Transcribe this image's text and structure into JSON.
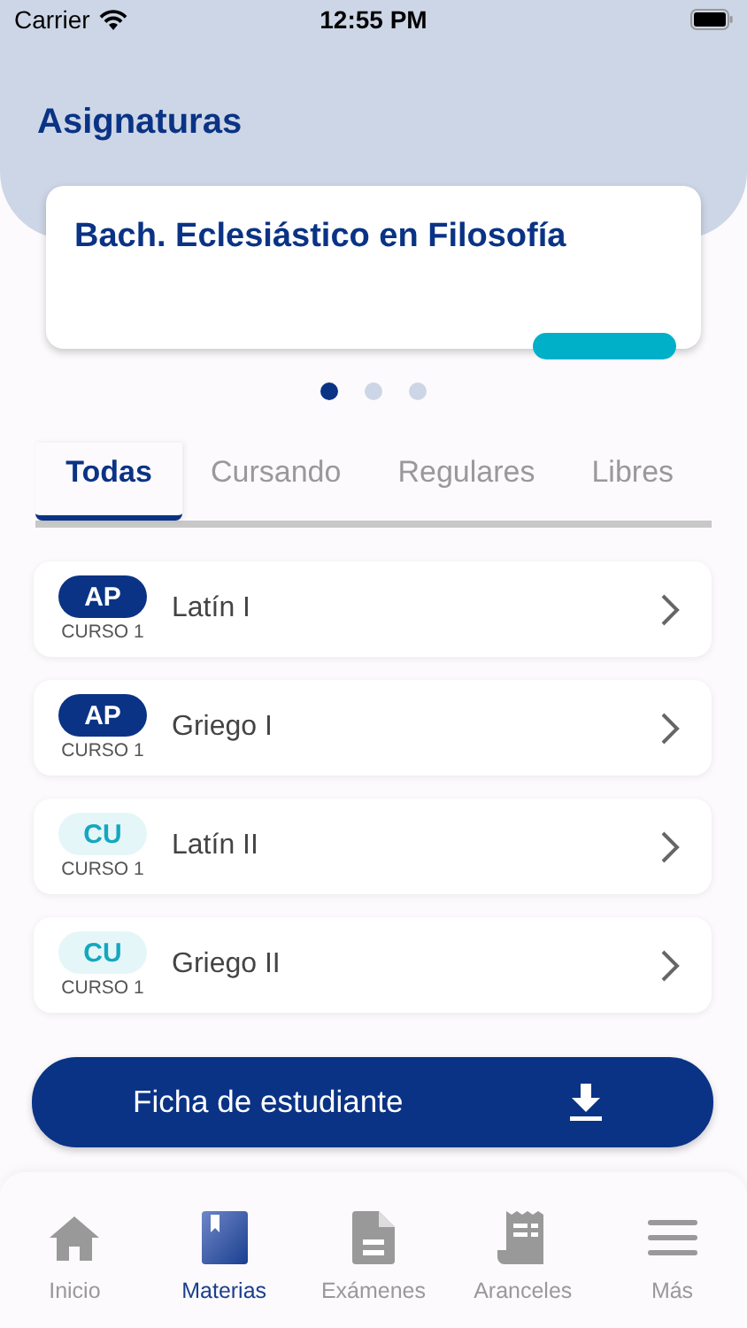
{
  "status_bar": {
    "carrier": "Carrier",
    "time": "12:55 PM"
  },
  "header": {
    "title": "Asignaturas"
  },
  "carousel": {
    "cards": [
      {
        "title": "Bach. Eclesiástico en Filosofía"
      }
    ],
    "dots": [
      {
        "selected": true
      },
      {
        "selected": false
      },
      {
        "selected": false
      }
    ]
  },
  "tabs": [
    {
      "label": "Todas",
      "selected": true
    },
    {
      "label": "Cursando",
      "selected": false
    },
    {
      "label": "Regulares",
      "selected": false
    },
    {
      "label": "Libres",
      "selected": false
    }
  ],
  "subjects": [
    {
      "badge": "AP",
      "kind": "dark",
      "course": "CURSO 1",
      "name": "Latín I"
    },
    {
      "badge": "AP",
      "kind": "dark",
      "course": "CURSO 1",
      "name": "Griego I"
    },
    {
      "badge": "CU",
      "kind": "light",
      "course": "CURSO 1",
      "name": "Latín II"
    },
    {
      "badge": "CU",
      "kind": "light",
      "course": "CURSO 1",
      "name": "Griego II"
    }
  ],
  "download_button": {
    "label": "Ficha de estudiante"
  },
  "bottom_nav": [
    {
      "label": "Inicio",
      "selected": false
    },
    {
      "label": "Materias",
      "selected": true
    },
    {
      "label": "Exámenes",
      "selected": false
    },
    {
      "label": "Aranceles",
      "selected": false
    },
    {
      "label": "Más",
      "selected": false
    }
  ]
}
